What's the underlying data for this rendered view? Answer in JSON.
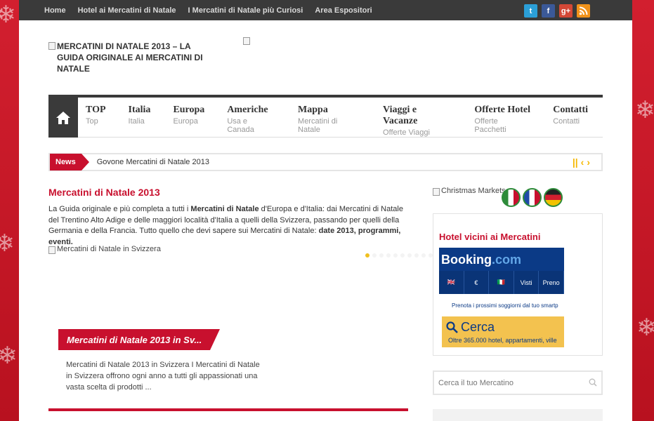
{
  "topbar": {
    "links": [
      "Home",
      "Hotel ai Mercatini di Natale",
      "I Mercatini di Natale più Curiosi",
      "Area Espositori"
    ]
  },
  "social": {
    "twitter": "t",
    "facebook": "f",
    "google": "g+",
    "rss": "rss"
  },
  "header": {
    "logo_alt": "MERCATINI DI NATALE 2013 – LA GUIDA ORIGINALE AI MERCATINI DI NATALE"
  },
  "nav": {
    "items": [
      {
        "title": "TOP",
        "sub": "Top"
      },
      {
        "title": "Italia",
        "sub": "Italia"
      },
      {
        "title": "Europa",
        "sub": "Europa"
      },
      {
        "title": "Americhe",
        "sub": "Usa e Canada"
      },
      {
        "title": "Mappa",
        "sub": "Mercatini di Natale"
      },
      {
        "title": "Viaggi e Vacanze",
        "sub": "Offerte Viaggi"
      },
      {
        "title": "Offerte Hotel",
        "sub": "Offerte Pacchetti"
      },
      {
        "title": "Contatti",
        "sub": "Contatti"
      }
    ]
  },
  "ticker": {
    "label": "News",
    "text": "Govone Mercatini di Natale 2013",
    "pause": "||",
    "prev": "‹",
    "next": "›"
  },
  "main": {
    "title": "Mercatini di Natale 2013",
    "intro_1": "La Guida originale e più completa a tutti i ",
    "intro_bold_1": "Mercatini di Natale",
    "intro_2": " d'Europa e d'Italia: dai Mercatini di Natale del Trentino Alto Adige e delle maggiori località d'Italia a quelli della Svizzera, passando per quelli della Germania e della Francia. Tutto quello che devi sapere sui Mercatini di Natale: ",
    "intro_bold_2": "date 2013, programmi, eventi.",
    "slider_alt": "Mercatini di Natale in Svizzera",
    "slide_title": "Mercatini di Natale 2013 in Sv...",
    "slide_desc": "Mercatini di Natale 2013 in Svizzera   I Mercatini di Natale in Svizzera offrono ogni anno a tutti gli appassionati una vasta scelta di prodotti ..."
  },
  "sidebar": {
    "xmas_alt": "Christmas Markets",
    "widget_title": "Hotel vicini ai Mercatini",
    "booking_logo_a": "Booking",
    "booking_logo_b": ".com",
    "booking_row": [
      "🇬🇧",
      "€",
      "🇮🇹",
      "Visti",
      "Preno"
    ],
    "booking_small": "Prenota i prossimi soggiorni dal tuo smartp",
    "cerca": "Cerca",
    "cerca_sub": "Oltre 365.000 hotel, appartamenti, ville",
    "search_placeholder": "Cerca il tuo Mercatino"
  }
}
